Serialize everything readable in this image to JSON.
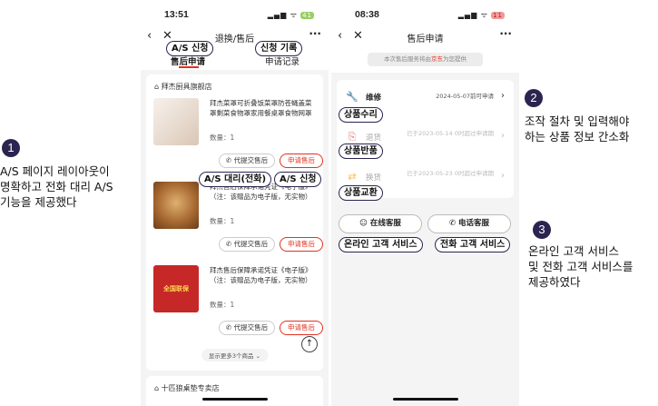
{
  "annotations": {
    "step1": {
      "number": "1",
      "text": "A/S 페이지 레이아웃이\n 명확하고 전화 대리 A/S\n기능을 제공했다"
    },
    "step2": {
      "number": "2",
      "text": "조작 절차 및 입력해야\n하는 상품 정보 간소화"
    },
    "step3": {
      "number": "3",
      "text": "온라인 고객 서비스\n및 전화 고객 서비스를\n제공하였다"
    },
    "tags": {
      "as_apply_top": "A/S 신청",
      "apply_record": "신청 기록",
      "as_proxy_phone": "A/S 대리(전화)",
      "as_apply_mid": "A/S 신청",
      "repair": "상품수리",
      "return": "상품반품",
      "exchange": "상품교환",
      "online_cs": "온라인 고객 서비스",
      "phone_cs": "전화 고객 서비스"
    }
  },
  "phone1": {
    "time": "13:51",
    "battery": "41",
    "title": "退换/售后",
    "tabs": [
      "售后申请",
      "申请记录"
    ],
    "store1": "拜杰厨具旗舰店",
    "products": [
      {
        "title": "拜杰菜罩可折叠饭菜罩防苍蝇盖菜罩剩菜食物罩家用餐桌罩食物网罩 清...",
        "qty": "数量：1",
        "proxy": "代提交售后",
        "apply": "申请售后"
      },
      {
        "title": "拜杰售后保障承诺凭证《电子版》\n（注：该赠品为电子版，无实物）",
        "qty": "数量：1",
        "proxy": "代提交售后",
        "apply": "申请售后"
      },
      {
        "title": "拜杰售后保障承诺凭证《电子版》\n（注：该赠品为电子版，无实物）",
        "qty": "数量：1",
        "proxy": "代提交售后",
        "apply": "申请售后"
      }
    ],
    "more": "显示更多3个商品 ⌄",
    "store2": "十匹狼桌垫专卖店",
    "img_badge": "全国联保"
  },
  "phone2": {
    "time": "08:38",
    "battery": "11",
    "title": "售后申请",
    "notice_prefix": "本次售后服务将由",
    "notice_brand": "京东",
    "notice_suffix": "为您提供",
    "services": [
      {
        "name": "维修",
        "note": "2024-05-07前可申请",
        "active": true,
        "icon": "wrench-icon"
      },
      {
        "name": "退货",
        "note": "已于2023-05-14 0时超过申请期",
        "active": false,
        "icon": "return-icon"
      },
      {
        "name": "换货",
        "note": "已于2023-05-23 0时超过申请期",
        "active": false,
        "icon": "exchange-icon"
      }
    ],
    "online_cs": "在线客服",
    "phone_cs": "电话客服"
  },
  "colors": {
    "accent": "#e0321f",
    "annotation": "#2b2450"
  }
}
